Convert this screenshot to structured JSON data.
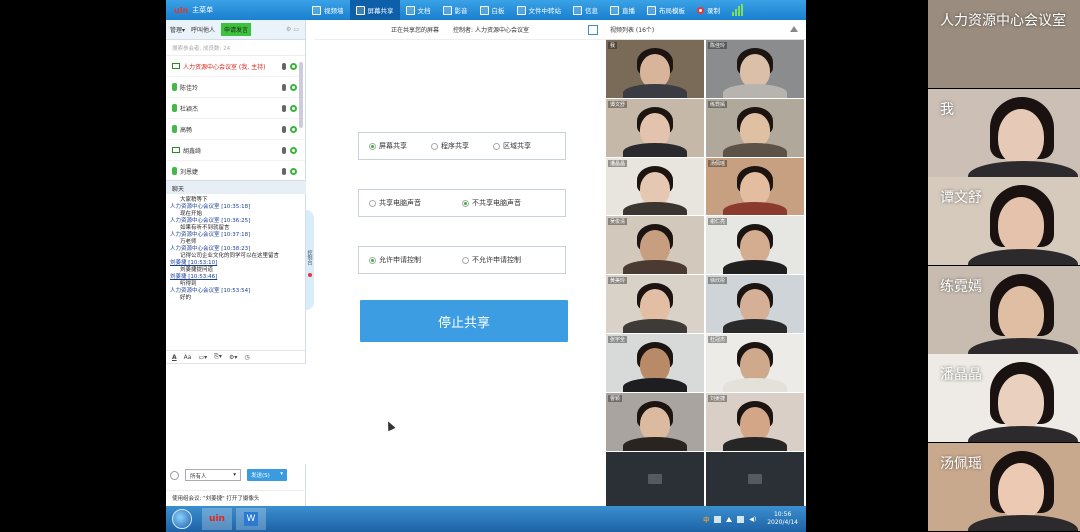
{
  "toolbar": {
    "brand_logo": "uin",
    "brand_label": "主菜单",
    "items": [
      {
        "label": "视频墙",
        "active": false
      },
      {
        "label": "屏幕共享",
        "active": true
      },
      {
        "label": "文档",
        "active": false
      },
      {
        "label": "影音",
        "active": false
      },
      {
        "label": "白板",
        "active": false
      },
      {
        "label": "文件中转站",
        "active": false
      },
      {
        "label": "信息",
        "active": false
      },
      {
        "label": "直播",
        "active": false
      },
      {
        "label": "布局模板",
        "active": false
      }
    ],
    "record_label": "录制"
  },
  "left_panel": {
    "tabs": {
      "manage": "管理▾",
      "call": "呼叫他人",
      "green": "申请发言"
    },
    "search_placeholder": "搜索参会者, 成员数: 24",
    "members": [
      {
        "name": "人力资源中心会议室 (我, 主持)",
        "host": true,
        "icon": "monitor-icon"
      },
      {
        "name": "陈佳玲",
        "host": false,
        "icon": "mic-icon"
      },
      {
        "name": "杜颖杰",
        "host": false,
        "icon": "mic-icon"
      },
      {
        "name": "高畅",
        "host": false,
        "icon": "mic-icon"
      },
      {
        "name": "胡鑫绮",
        "host": false,
        "icon": "monitor-icon"
      },
      {
        "name": "刘恩婕",
        "host": false,
        "icon": "mic-icon"
      }
    ],
    "chat_title": "聊天",
    "chat": [
      {
        "type": "msg",
        "text": "大家稍等下"
      },
      {
        "type": "sys",
        "text": "人力资源中心会议室 [10:35:18]"
      },
      {
        "type": "msg",
        "text": "现在开始"
      },
      {
        "type": "sys",
        "text": "人力资源中心会议室 [10:36:25]"
      },
      {
        "type": "msg",
        "text": "如果有听不到就留言"
      },
      {
        "type": "sys",
        "text": "人力资源中心会议室 [10:37:18]"
      },
      {
        "type": "msg",
        "text": "万老师"
      },
      {
        "type": "sys",
        "text": "人力资源中心会议室 [10:38:23]"
      },
      {
        "type": "msg",
        "text": "记得公司企业文化的同学可以在这里留言"
      },
      {
        "type": "link",
        "text": "刘姜捷 [10:53:10]"
      },
      {
        "type": "msg",
        "text": "刘姜捷提问道"
      },
      {
        "type": "link",
        "text": "刘姜捷 [10:53:46]"
      },
      {
        "type": "msg",
        "text": "听得到"
      },
      {
        "type": "sys",
        "text": "人力资源中心会议室 [10:53:54]"
      },
      {
        "type": "msg",
        "text": "好的"
      }
    ],
    "recipient": "所有人",
    "send_label": "发送(S)",
    "status": "使用组会议: \"刘姜捷\" 打开了摄像头"
  },
  "side_tab": "控制台",
  "center": {
    "share_status": "正在共享您的屏幕",
    "controller": "控制者: 人力资源中心会议室",
    "group1": [
      "屏幕共享",
      "程序共享",
      "区域共享"
    ],
    "group1_selected": 0,
    "group2": [
      "共享电脑声音",
      "不共享电脑声音"
    ],
    "group2_selected": 1,
    "group3": [
      "允许申请控制",
      "不允许申请控制"
    ],
    "group3_selected": 0,
    "stop_button": "停止共享"
  },
  "video_list": {
    "title": "视频列表 (16个)",
    "tiles": [
      {
        "name": "我",
        "bg": "#7a6a58",
        "skin": "#d8b49a",
        "shirt": "#3b3b44"
      },
      {
        "name": "陈佳玲",
        "bg": "#8b8c8e",
        "skin": "#dcbfa8",
        "shirt": "#b7b4b0"
      },
      {
        "name": "谭文舒",
        "bg": "#c6b8a8",
        "skin": "#e3c3ad",
        "shirt": "#2a2a2e"
      },
      {
        "name": "练霓嫣",
        "bg": "#b0a89a",
        "skin": "#e0c0a3",
        "shirt": "#5d5248"
      },
      {
        "name": "潘晶晶",
        "bg": "#e8e4de",
        "skin": "#e6c8b2",
        "shirt": "#3a3530"
      },
      {
        "name": "汤佩瑶",
        "bg": "#c6a080",
        "skin": "#e4bca0",
        "shirt": "#8b3a2e"
      },
      {
        "name": "吴俊清",
        "bg": "#d2c8bc",
        "skin": "#c89e80",
        "shirt": "#4a3a32"
      },
      {
        "name": "谢仁亮",
        "bg": "#e6e6e2",
        "skin": "#d4ac90",
        "shirt": "#202020"
      },
      {
        "name": "黄美玲",
        "bg": "#d8d2c8",
        "skin": "#e2bea4",
        "shirt": "#3e3a38"
      },
      {
        "name": "徐欣彤",
        "bg": "#cfd4d8",
        "skin": "#d6b096",
        "shirt": "#2a2a2a"
      },
      {
        "name": "张宇全",
        "bg": "#d7dad8",
        "skin": "#b88a68",
        "shirt": "#1e1e22"
      },
      {
        "name": "杜冠杰",
        "bg": "#ecebe8",
        "skin": "#cfa98c",
        "shirt": "#e4e0da"
      },
      {
        "name": "曹颖",
        "bg": "#aaa4a0",
        "skin": "#dcbaa0",
        "shirt": "#2a2420"
      },
      {
        "name": "刘姜捷",
        "bg": "#d9cfc6",
        "skin": "#d2a686",
        "shirt": "#262626"
      },
      {
        "name": "",
        "bg": "",
        "skin": "",
        "shirt": ""
      },
      {
        "name": "",
        "bg": "",
        "skin": "",
        "shirt": ""
      }
    ]
  },
  "taskbar": {
    "app1": "uin",
    "app2": "W",
    "ime": "中",
    "time": "10:56",
    "date": "2020/4/14"
  },
  "phone_strip": [
    {
      "label": "人力资源中心会议室",
      "bg": "#9a8c7e",
      "skin": "",
      "hair": false
    },
    {
      "label": "我",
      "bg": "#cbbfb6",
      "skin": "#e6c9b6",
      "hair": true
    },
    {
      "label": "谭文舒",
      "bg": "#d6cabd",
      "skin": "#e4c2ab",
      "hair": true
    },
    {
      "label": "练霓嫣",
      "bg": "#c8bcb0",
      "skin": "#e0bea3",
      "hair": true
    },
    {
      "label": "潘晶晶",
      "bg": "#eeeae6",
      "skin": "#ead0be",
      "hair": true
    },
    {
      "label": "汤佩瑶",
      "bg": "#c9a98e",
      "skin": "#ecc9b2",
      "hair": true
    }
  ]
}
